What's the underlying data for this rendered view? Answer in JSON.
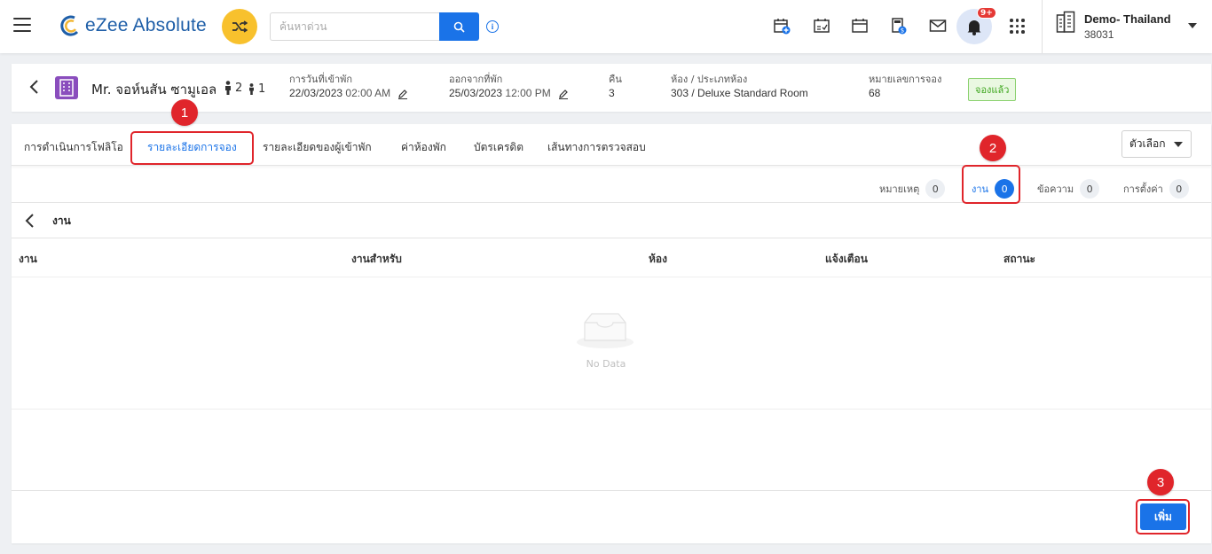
{
  "app": {
    "logo_text": "eZee Absolute"
  },
  "search": {
    "placeholder": "ค้นหาด่วน"
  },
  "notifications": {
    "badge": "9+"
  },
  "property": {
    "name": "Demo- Thailand",
    "id": "38031"
  },
  "reservation": {
    "guest_name": "Mr. จอห์นสัน ซามูเอล",
    "adults": "2",
    "children": "1",
    "arrival_label": "การวันที่เข้าพัก",
    "arrival_date": "22/03/2023",
    "arrival_time": "02:00 AM",
    "departure_label": "ออกจากที่พัก",
    "departure_date": "25/03/2023",
    "departure_time": "12:00 PM",
    "nights_label": "คืน",
    "nights": "3",
    "room_label": "ห้อง / ประเภทห้อง",
    "room": "303 / Deluxe Standard Room",
    "res_no_label": "หมายเลขการจอง",
    "res_no": "68",
    "status": "จองแล้ว"
  },
  "tabs": [
    {
      "label": "การดำเนินการโฟลิโอ"
    },
    {
      "label": "รายละเอียดการจอง"
    },
    {
      "label": "รายละเอียดของผู้เข้าพัก"
    },
    {
      "label": "ค่าห้องพัก"
    },
    {
      "label": "บัตรเครดิต"
    },
    {
      "label": "เส้นทางการตรวจสอบ"
    }
  ],
  "options_label": "ตัวเลือก",
  "subtabs": [
    {
      "label": "หมายเหตุ",
      "count": "0"
    },
    {
      "label": "งาน",
      "count": "0"
    },
    {
      "label": "ข้อความ",
      "count": "0"
    },
    {
      "label": "การตั้งค่า",
      "count": "0"
    }
  ],
  "section_title": "งาน",
  "table": {
    "columns": [
      "งาน",
      "งานสำหรับ",
      "ห้อง",
      "แจ้งเตือน",
      "สถานะ"
    ],
    "empty_text": "No Data"
  },
  "add_button": "เพิ่ม",
  "callouts": [
    "1",
    "2",
    "3"
  ],
  "colors": {
    "accent": "#1a73e8",
    "callout": "#e0252b",
    "status_green": "#3da61d"
  }
}
